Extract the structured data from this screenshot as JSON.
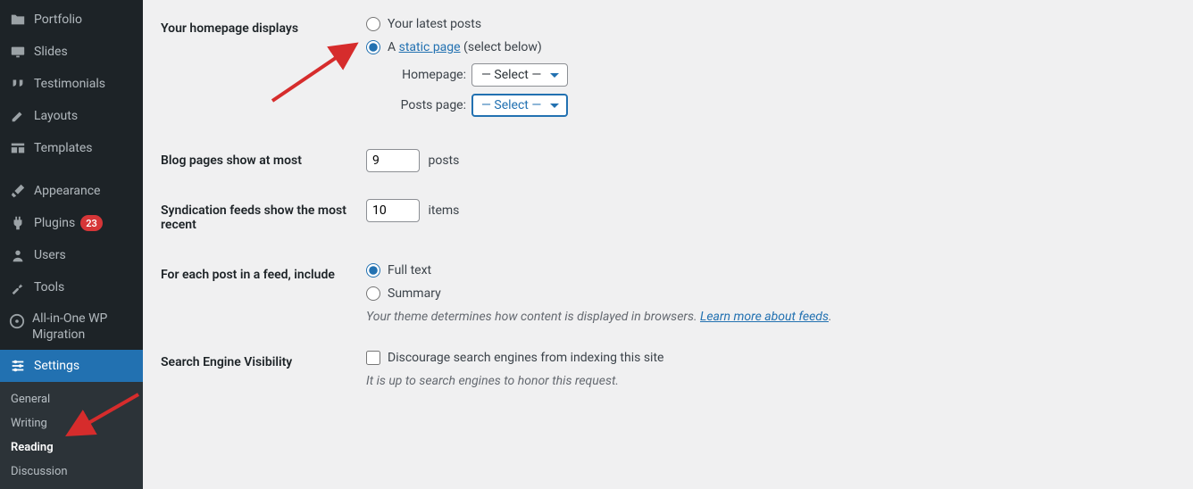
{
  "sidebar": {
    "items": [
      {
        "label": "Portfolio",
        "icon": "folder-icon"
      },
      {
        "label": "Slides",
        "icon": "slides-icon"
      },
      {
        "label": "Testimonials",
        "icon": "quote-icon"
      },
      {
        "label": "Layouts",
        "icon": "pencil-icon"
      },
      {
        "label": "Templates",
        "icon": "grid-icon"
      }
    ],
    "items2": [
      {
        "label": "Appearance",
        "icon": "brush-icon"
      },
      {
        "label": "Plugins",
        "icon": "plug-icon",
        "badge": "23"
      },
      {
        "label": "Users",
        "icon": "user-icon"
      },
      {
        "label": "Tools",
        "icon": "wrench-icon"
      },
      {
        "label": "All-in-One WP Migration",
        "icon": "migration-icon"
      },
      {
        "label": "Settings",
        "icon": "settings-icon",
        "current": true
      }
    ],
    "sub": [
      {
        "label": "General"
      },
      {
        "label": "Writing"
      },
      {
        "label": "Reading",
        "current": true
      },
      {
        "label": "Discussion"
      }
    ]
  },
  "settings": {
    "homepage_displays": {
      "heading": "Your homepage displays",
      "latest_label": "Your latest posts",
      "static_prefix": "A ",
      "static_link": "static page",
      "static_suffix": " (select below)",
      "homepage_label": "Homepage:",
      "posts_page_label": "Posts page:",
      "select_placeholder": "— Select —"
    },
    "blog_pages": {
      "heading": "Blog pages show at most",
      "value": "9",
      "unit": "posts"
    },
    "syndication": {
      "heading": "Syndication feeds show the most recent",
      "value": "10",
      "unit": "items"
    },
    "feed_content": {
      "heading": "For each post in a feed, include",
      "full_text": "Full text",
      "summary": "Summary",
      "description_prefix": "Your theme determines how content is displayed in browsers. ",
      "description_link": "Learn more about feeds",
      "description_suffix": "."
    },
    "search_visibility": {
      "heading": "Search Engine Visibility",
      "checkbox_label": "Discourage search engines from indexing this site",
      "description": "It is up to search engines to honor this request."
    }
  },
  "colors": {
    "accent": "#2271b1",
    "danger": "#d63638",
    "sidebar_bg": "#1d2327"
  }
}
